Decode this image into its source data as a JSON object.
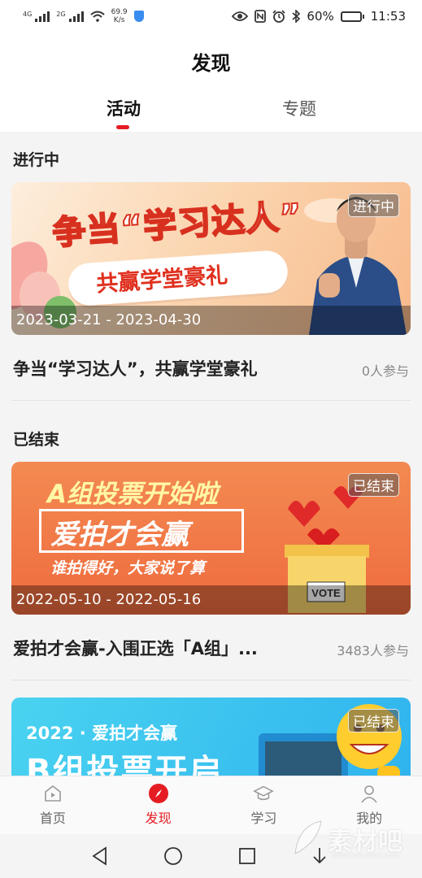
{
  "status_bar": {
    "net1": "4G",
    "net2": "2G",
    "speed_value": "69.9",
    "speed_unit": "K/s",
    "battery": "60%",
    "battery_level": 0.6,
    "time": "11:53",
    "icons": [
      "eye-icon",
      "nfc-icon",
      "alarm-icon",
      "bluetooth-icon"
    ]
  },
  "header": {
    "title": "发现",
    "tabs": [
      {
        "label": "活动",
        "active": true
      },
      {
        "label": "专题",
        "active": false
      }
    ]
  },
  "sections": {
    "ongoing": {
      "title": "进行中",
      "card": {
        "badge": "进行中",
        "date_range": "2023-03-21 - 2023-04-30",
        "banner_line1": "争当“学习达人”",
        "banner_line2": "共赢学堂豪礼",
        "title": "争当“学习达人”，共赢学堂豪礼",
        "participants": "0人参与"
      }
    },
    "ended": {
      "title": "已结束",
      "cards": [
        {
          "badge": "已结束",
          "date_range": "2022-05-10 - 2022-05-16",
          "banner_line1": "A组投票开始啦",
          "banner_line2": "爱拍才会赢",
          "banner_line3": "谁拍得好，大家说了算",
          "vote_label": "VOTE",
          "title": "爱拍才会赢-入围正选「A组」...",
          "participants": "3483人参与"
        },
        {
          "badge": "已结束",
          "banner_line1": "2022 · 爱拍才会赢",
          "banner_line2": "B组投票开启"
        }
      ]
    }
  },
  "bottom_nav": [
    {
      "label": "首页",
      "icon": "home-icon",
      "active": false
    },
    {
      "label": "发现",
      "icon": "compass-icon",
      "active": true
    },
    {
      "label": "学习",
      "icon": "graduation-cap-icon",
      "active": false
    },
    {
      "label": "我的",
      "icon": "user-icon",
      "active": false
    }
  ],
  "watermark": {
    "text": "素材吧",
    "url": "www.sucaibar.com"
  },
  "colors": {
    "accent": "#e51c23",
    "badge_bg": "#5a5a5a"
  }
}
